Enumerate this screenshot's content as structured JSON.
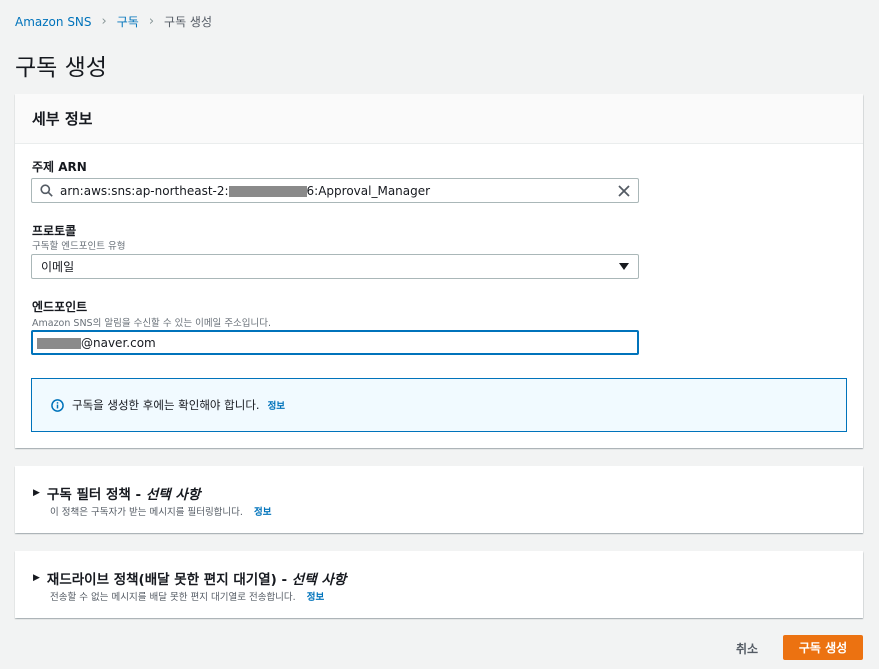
{
  "breadcrumb": {
    "items": [
      "Amazon SNS",
      "구독",
      "구독 생성"
    ]
  },
  "page_title": "구독 생성",
  "details": {
    "header": "세부 정보",
    "topic_arn": {
      "label": "주제 ARN",
      "value_prefix": "arn:aws:sns:ap-northeast-2:",
      "value_suffix": "6:Approval_Manager"
    },
    "protocol": {
      "label": "프로토콜",
      "description": "구독할 엔드포인트 유형",
      "selected": "이메일"
    },
    "endpoint": {
      "label": "엔드포인트",
      "description": "Amazon SNS의 알림을 수신할 수 있는 이메일 주소입니다.",
      "value_suffix": "@naver.com"
    },
    "info": {
      "text": "구독을 생성한 후에는 확인해야 합니다.",
      "link": "정보"
    }
  },
  "filter_policy": {
    "title": "구독 필터 정책 - ",
    "title_optional": "선택 사항",
    "description": "이 정책은 구독자가 받는 메시지를 필터링합니다.",
    "link": "정보"
  },
  "redrive_policy": {
    "title": "재드라이브 정책(배달 못한 편지 대기열) - ",
    "title_optional": "선택 사항",
    "description": "전송할 수 없는 메시지를 배달 못한 편지 대기열로 전송합니다.",
    "link": "정보"
  },
  "actions": {
    "cancel": "취소",
    "create": "구독 생성"
  },
  "colors": {
    "link": "#0073bb",
    "primary_button": "#ec7211",
    "background": "#f2f3f3"
  },
  "icons": [
    "search-icon",
    "clear-icon",
    "caret-down-icon",
    "info-icon",
    "expand-triangle-icon"
  ]
}
